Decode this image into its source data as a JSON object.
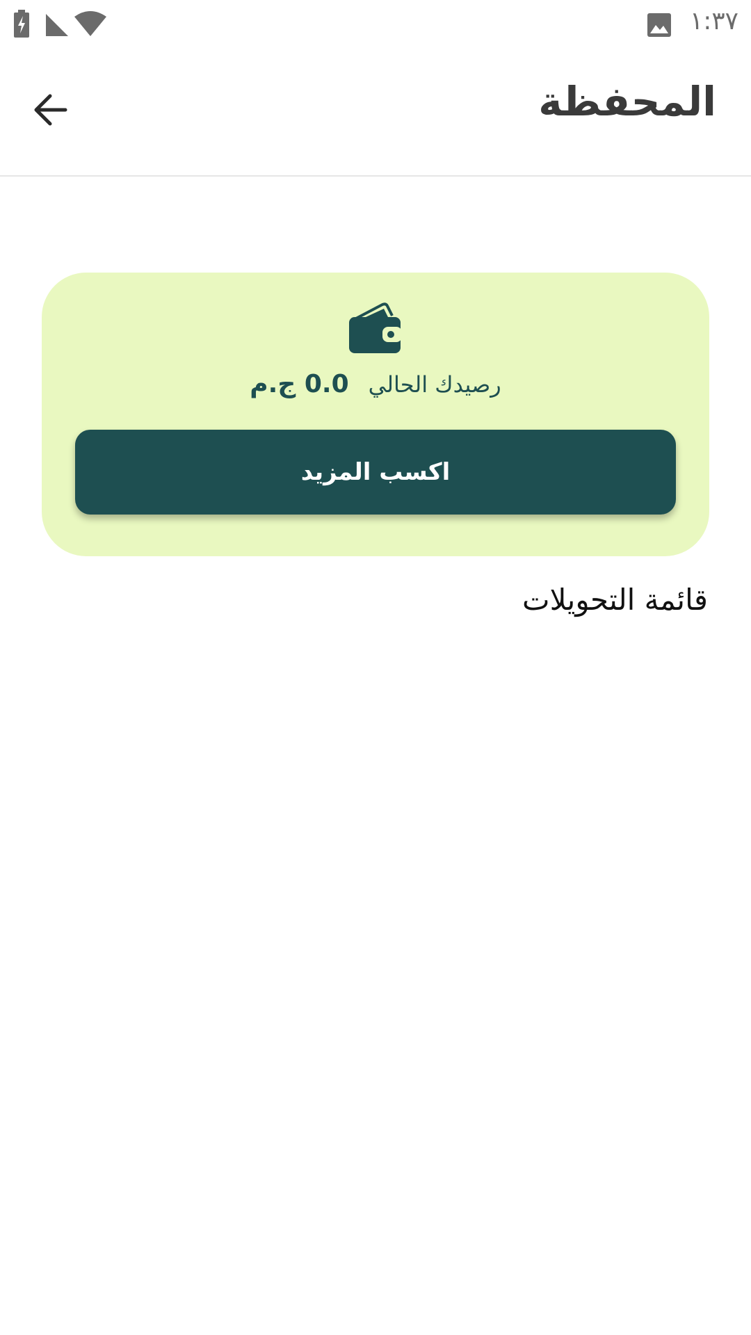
{
  "status_bar": {
    "time": "١:٣٧",
    "icons": [
      "battery-charging-icon",
      "signal-icon",
      "wifi-icon",
      "image-notification-icon"
    ]
  },
  "app_bar": {
    "title": "المحفظة",
    "back_icon": "arrow-back-icon"
  },
  "wallet_card": {
    "icon": "wallet-icon",
    "balance_label": "رصيدك الحالي",
    "balance_value": "0.0 ج.م",
    "earn_button_label": "اكسب المزيد"
  },
  "transactions": {
    "title": "قائمة التحويلات",
    "items": []
  },
  "colors": {
    "accent": "#1e4f51",
    "card_background": "#e9f8c0",
    "title_text": "#3a3a3a"
  }
}
